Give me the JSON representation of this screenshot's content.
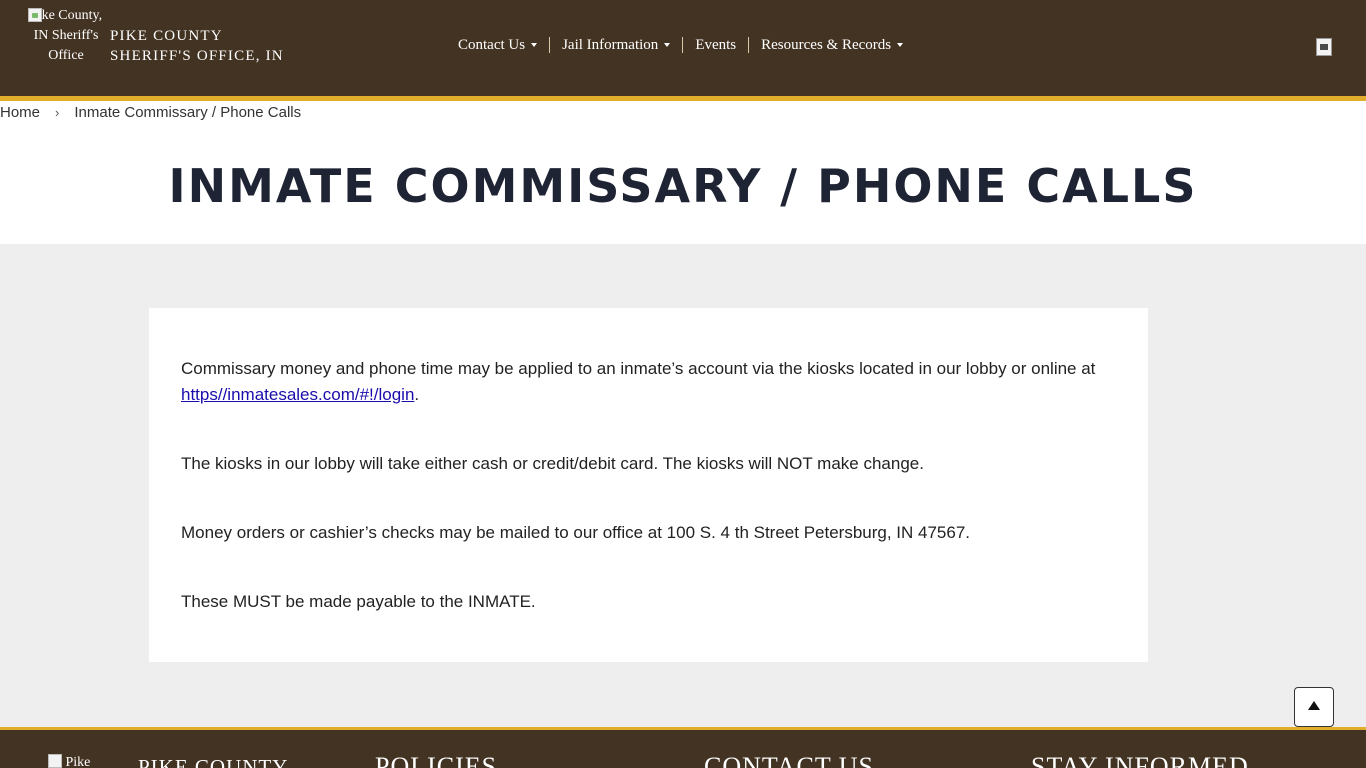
{
  "header": {
    "logo_alt": "Pike County, IN Sheriff's Office",
    "site_title_line1": "PIKE COUNTY",
    "site_title_line2": "SHERIFF'S OFFICE, IN",
    "nav": [
      {
        "label": "Contact Us",
        "dropdown": true
      },
      {
        "label": "Jail Information",
        "dropdown": true
      },
      {
        "label": "Events",
        "dropdown": false
      },
      {
        "label": "Resources & Records",
        "dropdown": true
      }
    ],
    "icon": "image-icon"
  },
  "breadcrumb": {
    "home": "Home",
    "separator": "›",
    "current": "Inmate Commissary / Phone Calls"
  },
  "page": {
    "title": "INMATE COMMISSARY / PHONE CALLS"
  },
  "content": {
    "p1_text": "Commissary money and phone time may be applied to an inmate’s account via the kiosks located in our lobby or online at ",
    "p1_link": "https//inmatesales.com/#!/login",
    "p1_end": ".",
    "p2": "The kiosks in our lobby will take either cash or credit/debit card. The kiosks will NOT make change.",
    "p3": "Money orders or cashier’s checks may be mailed to our office at 100 S. 4 th Street Petersburg, IN 47567.",
    "p4": "These MUST be made payable to the INMATE."
  },
  "footer": {
    "logo_alt": "Pike",
    "brand": "PIKE COUNTY",
    "headings": {
      "policies": "POLICIES",
      "contact": "CONTACT US",
      "stay": "STAY INFORMED"
    }
  },
  "colors": {
    "header_bg": "#433322",
    "accent": "#e2ad2c",
    "title": "#1e2433",
    "link": "#1a0dab",
    "page_bg": "#eeeeee"
  }
}
